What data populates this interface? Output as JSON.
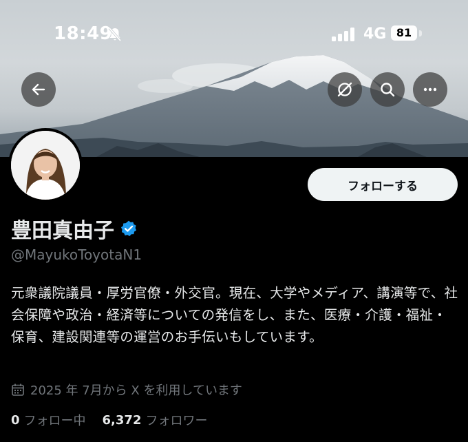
{
  "status_bar": {
    "time": "18:49",
    "network": "4G",
    "battery": "81",
    "icons": [
      "bell-slash-icon",
      "signal-icon",
      "battery-icon"
    ]
  },
  "header": {
    "icons": [
      "back-arrow-icon",
      "grok-icon",
      "search-icon",
      "more-icon"
    ]
  },
  "profile": {
    "display_name": "豊田真由子",
    "handle": "@MayukoToyotaN1",
    "follow_label": "フォローする",
    "bio": "元衆議院議員・厚労官僚・外交官。現在、大学やメディア、講演等で、社会保障や政治・経済等についての発信をし、また、医療・介護・福祉・保育、建設関連等の運営のお手伝いもしています。",
    "joined": "2025 年 7月から X を利用しています",
    "following_count": "0",
    "following_label": "フォロー中",
    "followers_count": "6,372",
    "followers_label": "フォロワー"
  },
  "colors": {
    "background": "#000000",
    "verified": "#1d9bf0",
    "muted_text": "#71767b",
    "button_bg": "#eff3f4"
  }
}
